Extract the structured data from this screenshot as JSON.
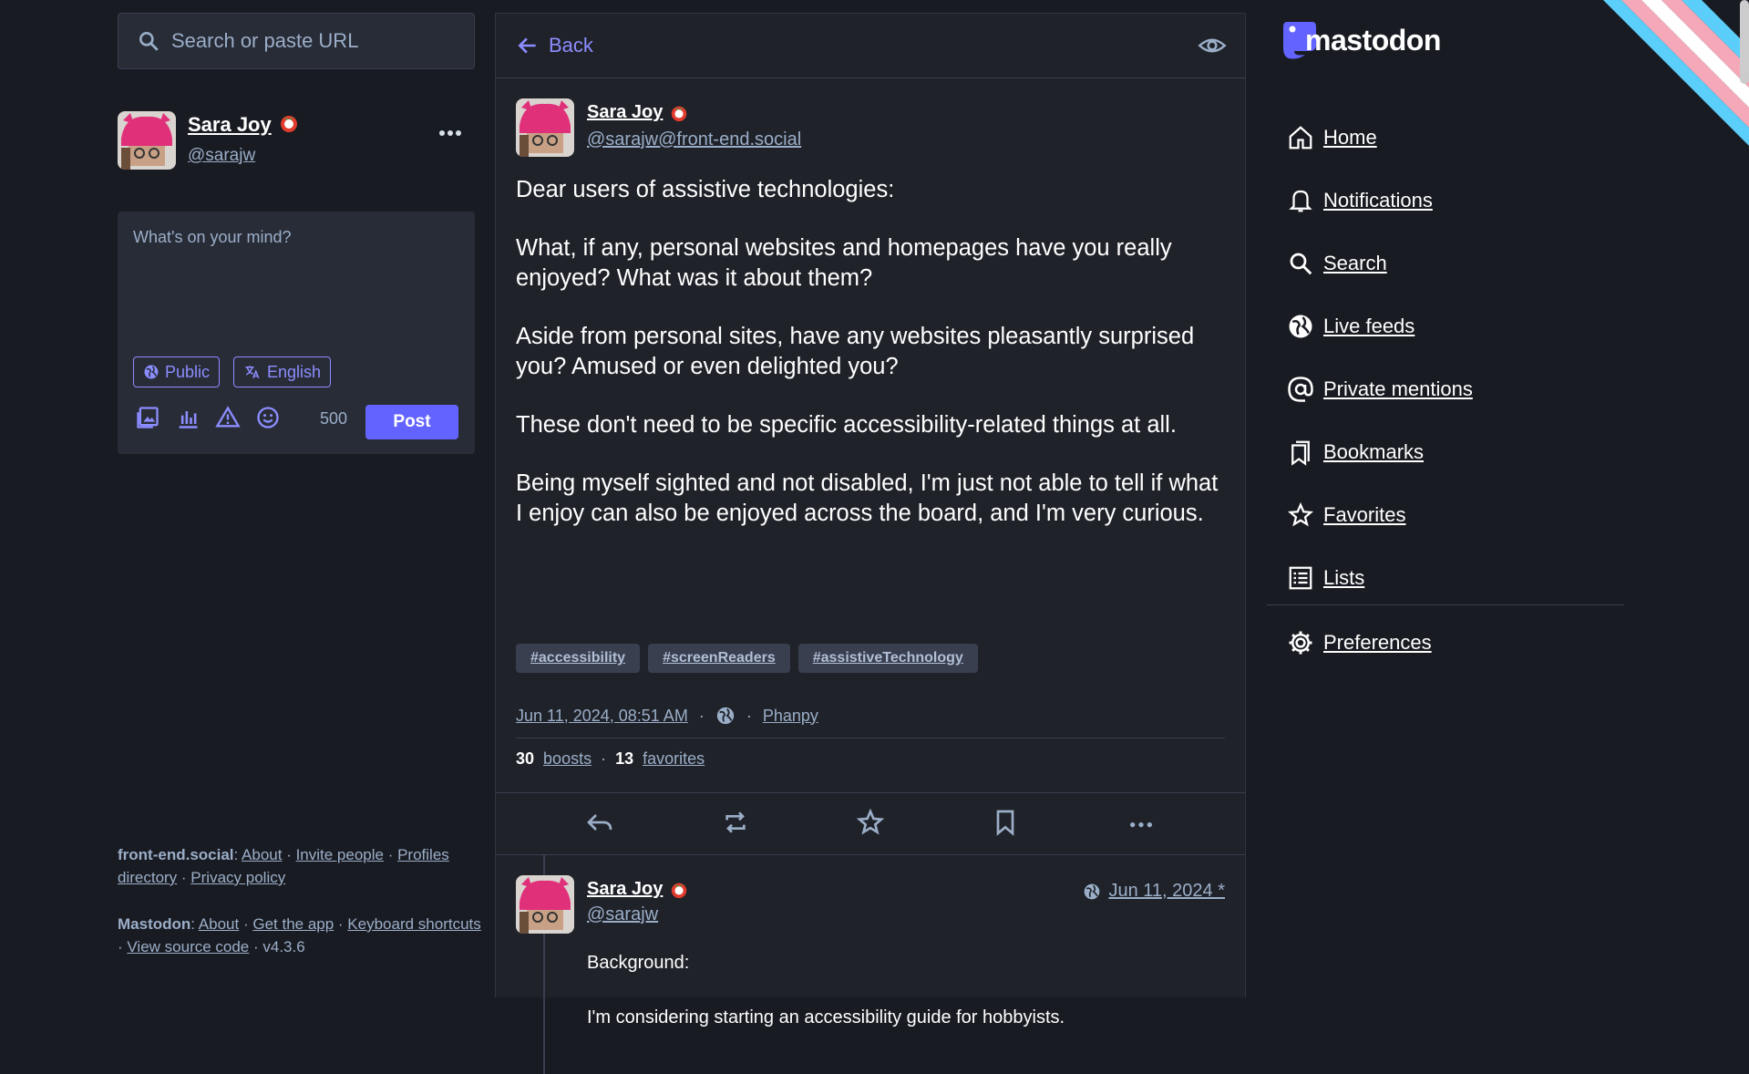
{
  "search": {
    "placeholder": "Search or paste URL"
  },
  "me": {
    "name": "Sara Joy",
    "handle": "@sarajw"
  },
  "compose": {
    "placeholder": "What's on your mind?",
    "visibility": "Public",
    "language": "English",
    "char_count": "500",
    "post_label": "Post"
  },
  "footer": {
    "server": "front-end.social",
    "server_links": [
      "About",
      "Invite people",
      "Profiles directory",
      "Privacy policy"
    ],
    "mastodon": "Mastodon",
    "mastodon_links": [
      "About",
      "Get the app",
      "Keyboard shortcuts",
      "View source code"
    ],
    "version": "v4.3.6"
  },
  "column": {
    "back_label": "Back"
  },
  "status": {
    "name": "Sara Joy",
    "acct": "@sarajw@front-end.social",
    "paragraphs": [
      "Dear users of assistive technologies:",
      "What, if any, personal websites and homepages have you really enjoyed? What was it about them?",
      "Aside from personal sites, have any websites pleasantly surprised you? Amused or even delighted you?",
      "These don't need to be specific accessibility-related things at all.",
      "Being myself sighted and not disabled, I'm just not able to tell if what I enjoy can also be enjoyed across the board, and I'm very curious."
    ],
    "tags": [
      "#accessibility",
      "#screenReaders",
      "#assistiveTechnology"
    ],
    "date": "Jun 11, 2024, 08:51 AM",
    "app": "Phanpy",
    "boosts_count": "30",
    "boosts_label": "boosts",
    "favs_count": "13",
    "favs_label": "favorites"
  },
  "reply": {
    "name": "Sara Joy",
    "acct": "@sarajw",
    "date": "Jun 11, 2024 *",
    "paragraphs": [
      "Background:",
      "I'm considering starting an accessibility guide for hobbyists."
    ]
  },
  "brand": {
    "wordmark": "mastodon",
    "accent": "#6364ff"
  },
  "nav": [
    {
      "label": "Home",
      "icon": "home-icon"
    },
    {
      "label": "Notifications",
      "icon": "bell-icon"
    },
    {
      "label": "Search",
      "icon": "search-icon"
    },
    {
      "label": "Live feeds",
      "icon": "globe-icon"
    },
    {
      "label": "Private mentions",
      "icon": "at-icon"
    },
    {
      "label": "Bookmarks",
      "icon": "bookmark-icon"
    },
    {
      "label": "Favorites",
      "icon": "star-icon"
    },
    {
      "label": "Lists",
      "icon": "list-icon"
    }
  ],
  "preferences": {
    "label": "Preferences",
    "icon": "gear-icon"
  }
}
